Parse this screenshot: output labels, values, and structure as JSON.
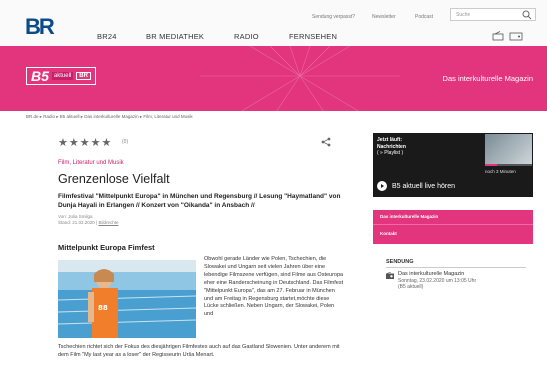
{
  "header": {
    "logo": "BR",
    "util_links": [
      "Sendung verpasst?",
      "Newsletter",
      "Podcast"
    ],
    "search_placeholder": "Suche",
    "nav": [
      "BR24",
      "BR MEDIATHEK",
      "RADIO",
      "FERNSEHEN"
    ]
  },
  "banner": {
    "logo_b5": "B5",
    "logo_aktuell": "aktuell",
    "logo_br": "BR",
    "title": "Das interkulturelle Magazin"
  },
  "breadcrumb": "BR.de ▸ Radio ▸ B5 aktuell ▸ Das interkulturelle Magazin ▸ Film, Literatur und Musik",
  "article": {
    "stars": "★★★★★",
    "rating_count": "(0)",
    "category": "Film, Literatur und Musik",
    "headline": "Grenzenlose Vielfalt",
    "teaser": "Filmfestival \"Mittelpunkt Europa\" in München und Regensburg // Lesung \"Haymatland\" von Dunja Hayali in Erlangen // Konzert von \"Oikanda\" in Ansbach //",
    "byline_author": "Von: Julia Smilga",
    "byline_date": "Stand: 21.02.2020",
    "byline_link": "Bildrechte",
    "subhead": "Mittelpunkt Europa Fimfest",
    "body_col": "Obwohl gerade Länder wie Polen, Tschechien, die Slowakei und Ungarn seit vielen Jahren über eine lebendige Filmszene verfügen, sind Filme aus Osteuropa eher eine Randerscheinung in Deutschland. Das Filmfest \"Mittelpunkt Europa\", das am 27. Februar in München und am Freitag in Regensburg startet,möchte diese Lücke schließen. Neben Ungarn, der Slowakei, Polen und",
    "body_full": "Tschechien richtet sich der Fokus des diesjährigen Filmfestes auch auf das Gastland Slowenien. Unter anderem mit dem Film \"My last year as a loser\" der Regisseurin Urša Menart."
  },
  "player": {
    "label1": "Jetzt läuft:",
    "label2": "Nachrichten",
    "label3": "( » Playlist )",
    "next": "noch 3 Minuten",
    "play_label": "B5 aktuell live hören",
    "progress": 0.25
  },
  "sidebar_links": [
    "Das interkulturelle Magazin",
    "Kontakt"
  ],
  "sendung": {
    "title": "SENDUNG",
    "name": "Das interkulturelle Magazin",
    "time": "Sonntag, 23.02.2020 um 13:05 Uhr",
    "station": "(B5 aktuell)"
  },
  "colors": {
    "accent": "#e2357e",
    "brand": "#0b4a8b"
  }
}
